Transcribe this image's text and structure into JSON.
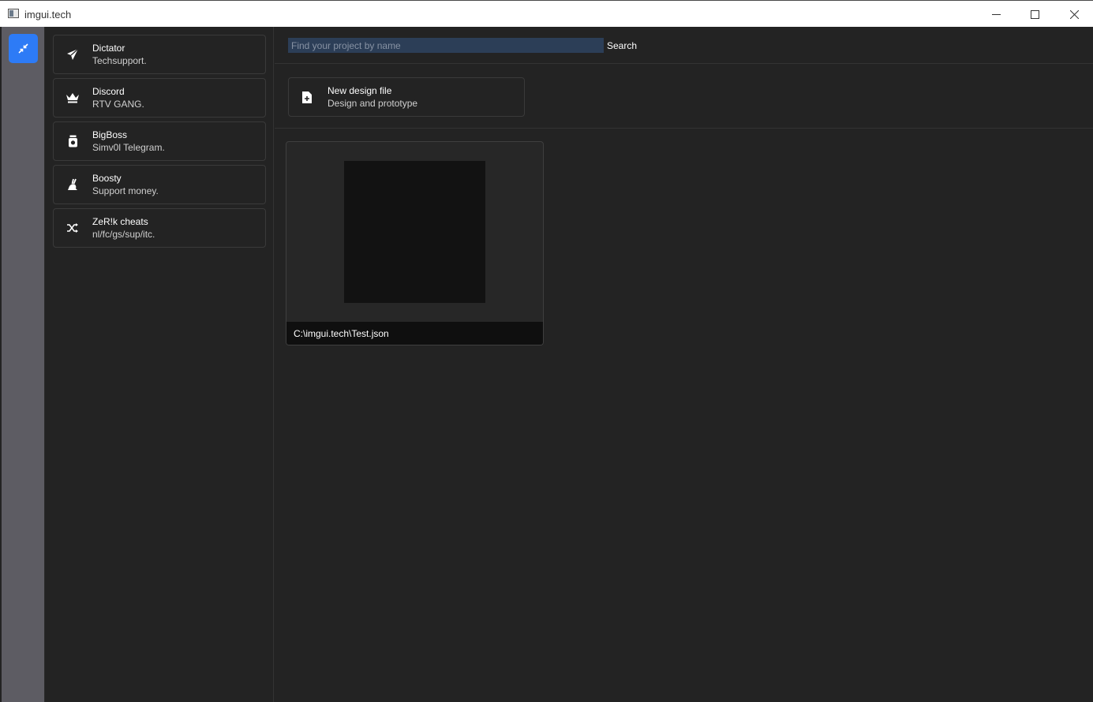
{
  "window": {
    "title": "imgui.tech",
    "controls": {
      "minimize": "minimize",
      "maximize": "maximize",
      "close": "close"
    }
  },
  "rail": {
    "toggle_icon": "collapse-arrows-icon",
    "accent": "#2d7bf6"
  },
  "sidebar": {
    "items": [
      {
        "title": "Dictator",
        "subtitle": "Techsupport.",
        "icon": "paper-plane-icon"
      },
      {
        "title": "Discord",
        "subtitle": "RTV GANG.",
        "icon": "crown-icon"
      },
      {
        "title": "BigBoss",
        "subtitle": "Simv0l Telegram.",
        "icon": "jar-icon"
      },
      {
        "title": "Boosty",
        "subtitle": "Support money.",
        "icon": "rabbit-icon"
      },
      {
        "title": "ZeR!k cheats",
        "subtitle": "nl/fc/gs/sup/itc.",
        "icon": "shuffle-icon"
      }
    ]
  },
  "search": {
    "placeholder": "Find your project by name",
    "button_label": "Search"
  },
  "new_file": {
    "title": "New design file",
    "subtitle": "Design and prototype",
    "icon": "file-plus-icon"
  },
  "projects": [
    {
      "path": "C:\\imgui.tech\\Test.json"
    }
  ]
}
